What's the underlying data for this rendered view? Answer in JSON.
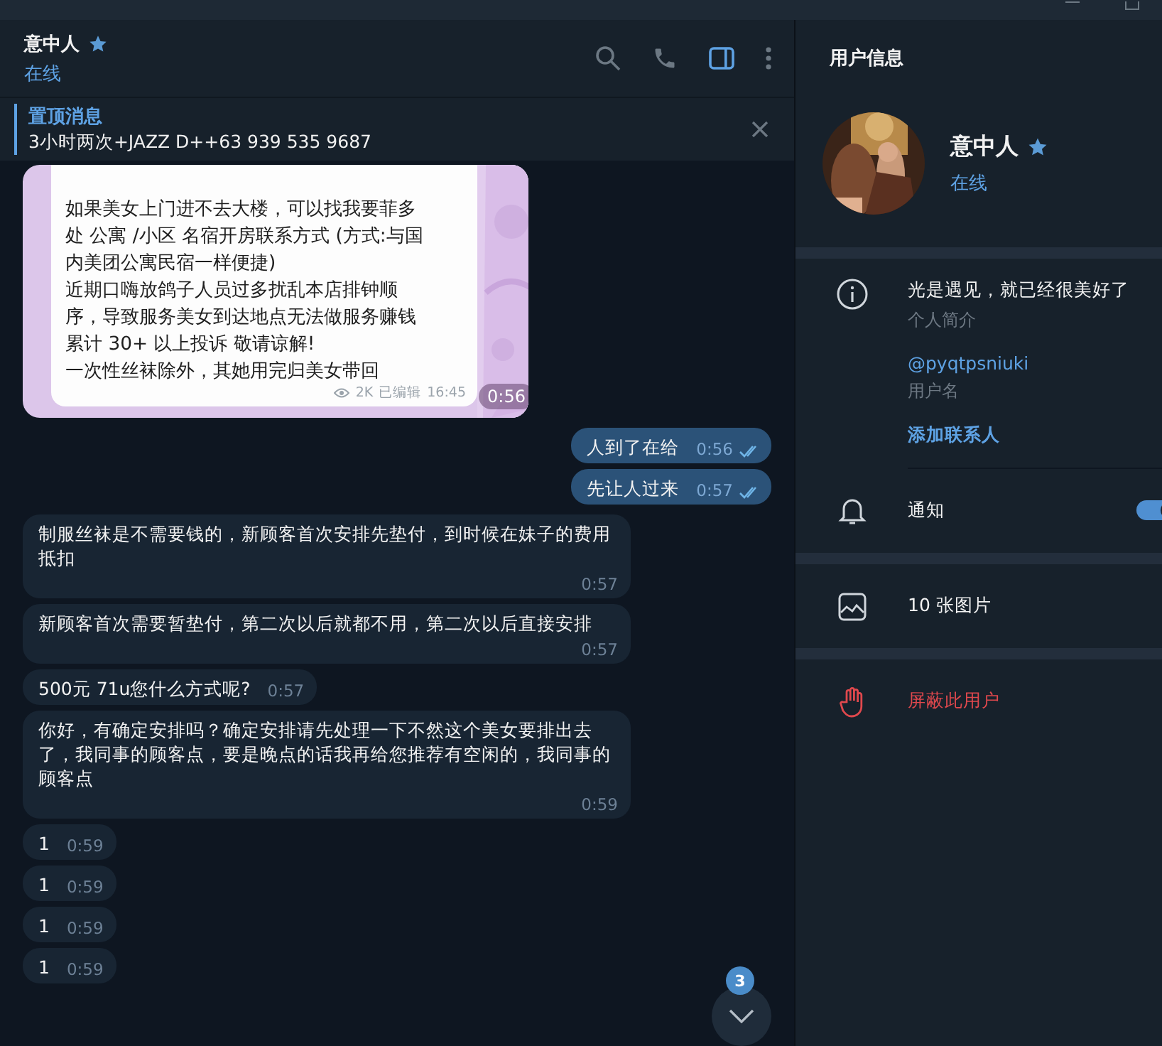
{
  "chat_header": {
    "title": "意中人",
    "status": "在线"
  },
  "pinned": {
    "label": "置顶消息",
    "text": "3小时两次+JAZZ D++63 939 535 9687"
  },
  "messages": [
    {
      "kind": "media",
      "text": "如果美女上门进不去大楼，可以找我要菲多处 公寓 /小区 名宿开房联系方式 (方式:与国内美团公寓民宿一样便捷)\n近期口嗨放鸽子人员过多扰乱本店排钟顺序，导致服务美女到达地点无法做服务赚钱累计 30+ 以上投诉 敬请谅解!\n一次性丝袜除外，其她用完归美女带回",
      "views": "2K",
      "edited": "已编辑",
      "time": "16:45",
      "duration": "0:56"
    },
    {
      "kind": "out",
      "text": "人到了在给",
      "time": "0:56",
      "read": true
    },
    {
      "kind": "out",
      "text": "先让人过来",
      "time": "0:57",
      "read": true
    },
    {
      "kind": "in",
      "text": "制服丝袜是不需要钱的，新顾客首次安排先垫付，到时候在妹子的费用抵扣",
      "time": "0:57"
    },
    {
      "kind": "in",
      "text": "新顾客首次需要暂垫付，第二次以后就都不用，第二次以后直接安排",
      "time": "0:57"
    },
    {
      "kind": "in",
      "text": "500元  71u您什么方式呢?",
      "time": "0:57"
    },
    {
      "kind": "in",
      "text": "你好，有确定安排吗？确定安排请先处理一下不然这个美女要排出去了，我同事的顾客点，要是晚点的话我再给您推荐有空闲的，我同事的顾客点",
      "time": "0:59"
    },
    {
      "kind": "in",
      "text": "1",
      "time": "0:59"
    },
    {
      "kind": "in",
      "text": "1",
      "time": "0:59"
    },
    {
      "kind": "in",
      "text": "1",
      "time": "0:59"
    },
    {
      "kind": "in",
      "text": "1",
      "time": "0:59"
    }
  ],
  "scroll_button": {
    "badge": "3"
  },
  "profile": {
    "heading": "用户信息",
    "name": "意中人",
    "status": "在线",
    "bio": "光是遇见，就已经很美好了",
    "bio_label": "个人简介",
    "username": "@pyqtpsniuki",
    "username_label": "用户名",
    "add_contact": "添加联系人",
    "notifications": {
      "label": "通知",
      "on": true
    },
    "media": "10 张图片",
    "block": "屏蔽此用户"
  }
}
